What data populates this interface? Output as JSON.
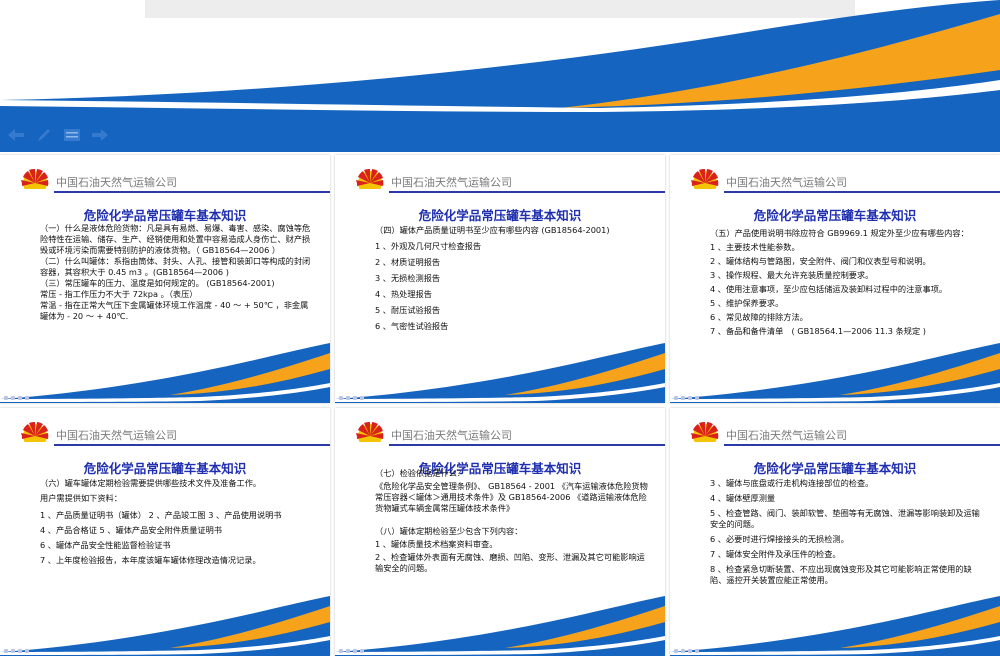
{
  "colors": {
    "blue": "#1565c0",
    "orange": "#f7a21b",
    "title": "#1f2fb0",
    "text": "#111111"
  },
  "company": "中国石油天然气运输公司",
  "slide_title": "危险化学品常压罐车基本知识",
  "nav": {
    "icons": [
      "back-arrow-icon",
      "pen-icon",
      "menu-icon",
      "forward-arrow-icon"
    ]
  },
  "slides": [
    {
      "paragraphs": [
        "（一）什么是液体危险货物：凡是具有易燃、易爆、毒害、感染、腐蚀等危险特性在运输、储存、生产、经销使用和处置中容易造成人身伤亡、财产损毁或环境污染而需要特别防护的液体货物。（ GB18564—2006 ）",
        "（二）什么叫罐体：系指由筒体、封头、人孔、接管和装卸口等构成的封闭容器，其容积大于 0.45 m3 。(GB18564—2006 )",
        "（三）常压罐车的压力、温度是如何规定的。 (GB18564-2001)",
        "常压 - 指工作压力不大于 72kpa 。（表压）",
        "常温 - 指在正常大气压下金属罐体环境工作温度 - 40 ～ + 50℃ ，非金属罐体为 - 20 ～ + 40℃."
      ]
    },
    {
      "paragraphs": [
        "（四）罐体产品质量证明书至少应有哪些内容 (GB18564-2001)",
        "1 、外观及几何尺寸检查报告",
        "2 、材质证明报告",
        "3 、无损检测报告",
        "4 、热处理报告",
        "5 、耐压试验报告",
        "6 、气密性试验报告"
      ]
    },
    {
      "paragraphs": [
        "（五）产品使用说明书除应符合 GB9969.1 规定外至少应有哪些内容：",
        "1 、主要技术性能参数。",
        "2 、罐体结构与管路图，安全附件、阀门和仪表型号和说明。",
        "3 、操作规程、最大允许充装质量控制要求。",
        "4 、使用注意事项，至少应包括储运及装卸料过程中的注意事项。",
        "5 、维护保养要求。",
        "6 、常见故障的排除方法。",
        "7 、备品和备件清单　( GB18564.1—2006 11.3 条规定 )"
      ]
    },
    {
      "paragraphs": [
        "（六）罐车罐体定期检验需要提供哪些技术文件及准备工作。",
        "用户需提供如下资料：",
        "1 、产品质量证明书（罐体） 2 、产品竣工图 3 、产品使用说明书",
        "4 、产品合格证 5 、罐体产品安全附件质量证明书",
        "6 、罐体产品安全性能监督检验证书",
        "7 、上年度检验报告，本年度该罐车罐体修理改造情况记录。"
      ]
    },
    {
      "paragraphs": [
        "（七）检验依据是什么？",
        "《危险化学品安全管理条例》、 GB18564 - 2001 《汽车运输液体危险货物常压容器＜罐体＞通用技术条件》及 GB18564-2006 《道路运输液体危险货物罐式车辆金属常压罐体技术条件》",
        "（八）罐体定期检验至少包含下列内容：",
        "1 、罐体质量技术档案资料审查。",
        "2 、检查罐体外表面有无腐蚀、磨损、凹陷、变形、泄漏及其它可能影响运输安全的问题。"
      ]
    },
    {
      "paragraphs": [
        "3 、罐体与底盘或行走机构连接部位的检查。",
        "4 、罐体壁厚测量",
        "5 、检查管路、阀门、装卸软管、垫圈等有无腐蚀、泄漏等影响装卸及运输安全的问题。",
        "6 、必要时进行焊接接头的无损检测。",
        "7 、罐体安全附件及承压件的检查。",
        "8 、检查紧急切断装置、不应出现腐蚀变形及其它可能影响正常使用的缺陷、遥控开关装置应能正常使用。"
      ]
    }
  ]
}
